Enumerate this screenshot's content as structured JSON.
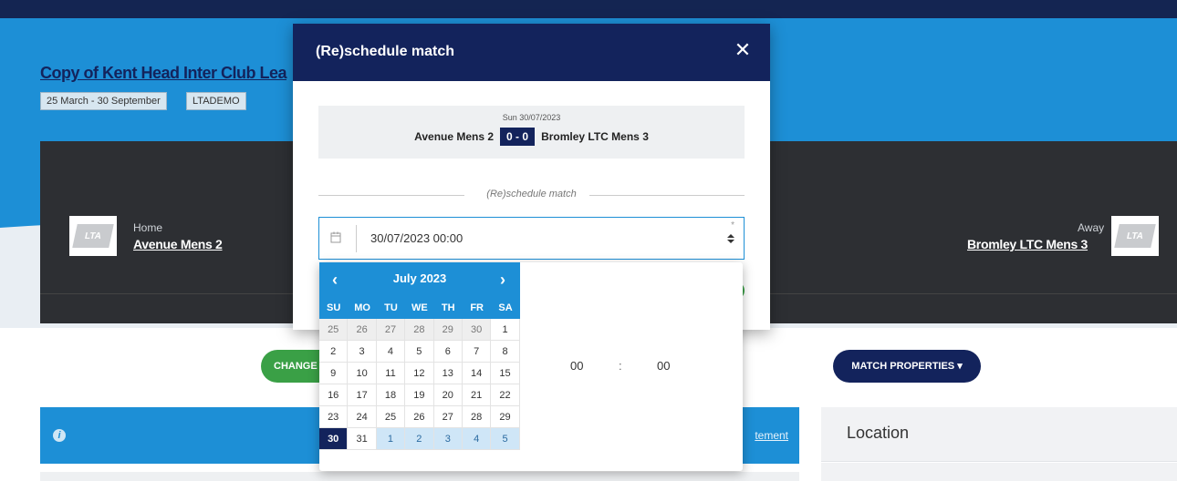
{
  "page": {
    "competition_title": "Copy of Kent Head Inter Club Lea",
    "chips": [
      "25 March - 30 September",
      "LTADEMO"
    ],
    "home_label": "Home",
    "home_team": "Avenue Mens 2",
    "away_label": "Away",
    "away_team": "Bromley LTC Mens 3",
    "logo_text": "LTA",
    "change_button": "CHANGE",
    "match_properties_button": "MATCH PROPERTIES ▾",
    "info_icon": "i",
    "info_link": "tement",
    "location_title": "Location"
  },
  "modal": {
    "title": "(Re)schedule match",
    "close_icon": "✕",
    "match_date": "Sun 30/07/2023",
    "home_team": "Avenue Mens 2",
    "score": "0 - 0",
    "away_team": "Bromley LTC Mens 3",
    "section_label": "(Re)schedule match",
    "date_value": "30/07/2023 00:00",
    "required_mark": "*",
    "dropdown_caret": "▲▼"
  },
  "picker": {
    "month_label": "July 2023",
    "prev_icon": "‹",
    "next_icon": "›",
    "weekdays": [
      "SU",
      "MO",
      "TU",
      "WE",
      "TH",
      "FR",
      "SA"
    ],
    "weeks": [
      [
        "25",
        "26",
        "27",
        "28",
        "29",
        "30",
        "1"
      ],
      [
        "2",
        "3",
        "4",
        "5",
        "6",
        "7",
        "8"
      ],
      [
        "9",
        "10",
        "11",
        "12",
        "13",
        "14",
        "15"
      ],
      [
        "16",
        "17",
        "18",
        "19",
        "20",
        "21",
        "22"
      ],
      [
        "23",
        "24",
        "25",
        "26",
        "27",
        "28",
        "29"
      ],
      [
        "30",
        "31",
        "1",
        "2",
        "3",
        "4",
        "5"
      ]
    ],
    "selected_day": "30",
    "hour": "00",
    "time_separator": ":",
    "minute": "00"
  },
  "colors": {
    "navy": "#13235c",
    "blue": "#1d8fd6",
    "green": "#3aa046",
    "dark_panel": "#2d2f33"
  }
}
